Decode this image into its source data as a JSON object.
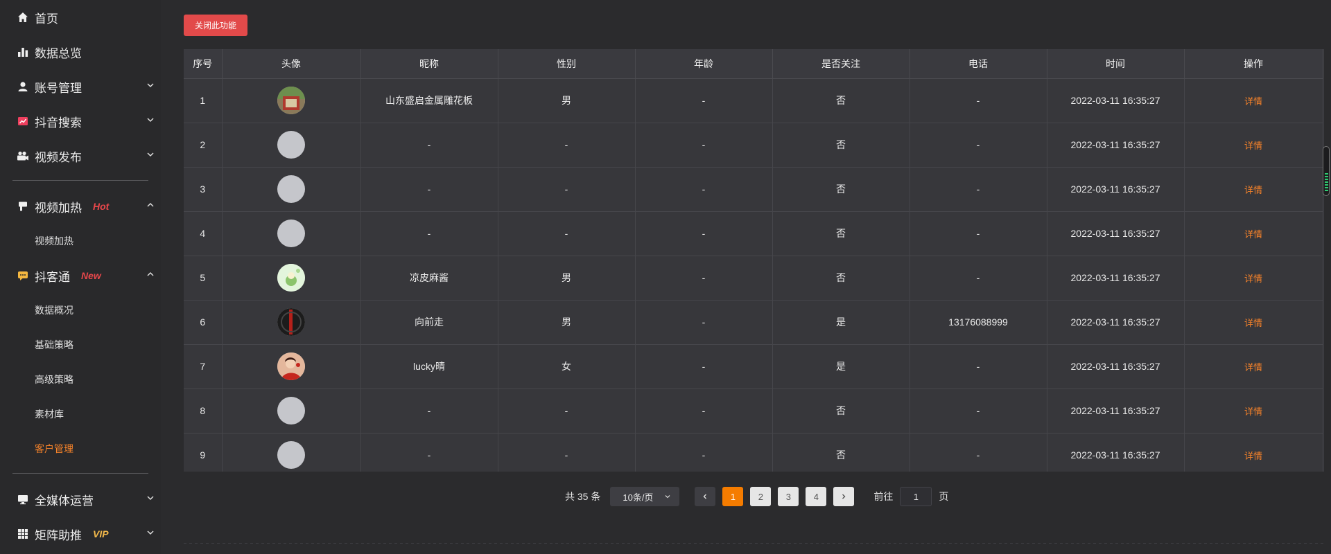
{
  "sidebar": {
    "items": [
      {
        "label": "首页",
        "icon": "home-icon",
        "expand": null
      },
      {
        "label": "数据总览",
        "icon": "bar-chart-icon",
        "expand": null
      },
      {
        "label": "账号管理",
        "icon": "user-icon",
        "expand": "down"
      },
      {
        "label": "抖音搜索",
        "icon": "trend-icon",
        "expand": "down"
      },
      {
        "label": "视频发布",
        "icon": "camera-icon",
        "expand": "down"
      },
      {
        "label": "视频加热",
        "icon": "fire-icon",
        "expand": "up",
        "tag": "Hot",
        "tag_color": "#e8474b"
      },
      {
        "label": "抖客通",
        "icon": "chat-icon",
        "expand": "up",
        "tag": "New",
        "tag_color": "#e8474b"
      },
      {
        "label": "全媒体运营",
        "icon": "monitor-icon",
        "expand": "down"
      },
      {
        "label": "矩阵助推",
        "icon": "grid-icon",
        "expand": "down",
        "tag": "VIP",
        "tag_color": "#f2b84b"
      }
    ],
    "sub_heat": [
      "视频加热"
    ],
    "sub_douke": [
      "数据概况",
      "基础策略",
      "高级策略",
      "素材库",
      "客户管理"
    ],
    "active_sub": "客户管理"
  },
  "toolbar": {
    "close_label": "关闭此功能"
  },
  "table": {
    "headers": [
      "序号",
      "头像",
      "昵称",
      "性别",
      "年龄",
      "是否关注",
      "电话",
      "时间",
      "操作"
    ],
    "rows": [
      {
        "no": "1",
        "avatar": "photo-red-gate",
        "nick": "山东盛启金属雕花板",
        "gender": "男",
        "age": "-",
        "follow": "否",
        "phone": "-",
        "time": "2022-03-11 16:35:27",
        "action": "详情"
      },
      {
        "no": "2",
        "avatar": "default",
        "nick": "-",
        "gender": "-",
        "age": "-",
        "follow": "否",
        "phone": "-",
        "time": "2022-03-11 16:35:27",
        "action": "详情"
      },
      {
        "no": "3",
        "avatar": "default",
        "nick": "-",
        "gender": "-",
        "age": "-",
        "follow": "否",
        "phone": "-",
        "time": "2022-03-11 16:35:27",
        "action": "详情"
      },
      {
        "no": "4",
        "avatar": "default",
        "nick": "-",
        "gender": "-",
        "age": "-",
        "follow": "否",
        "phone": "-",
        "time": "2022-03-11 16:35:27",
        "action": "详情"
      },
      {
        "no": "5",
        "avatar": "cartoon-green",
        "nick": "凉皮麻酱",
        "gender": "男",
        "age": "-",
        "follow": "否",
        "phone": "-",
        "time": "2022-03-11 16:35:27",
        "action": "详情"
      },
      {
        "no": "6",
        "avatar": "dark-red-line",
        "nick": "向前走",
        "gender": "男",
        "age": "-",
        "follow": "是",
        "phone": "13176088999",
        "time": "2022-03-11 16:35:27",
        "action": "详情"
      },
      {
        "no": "7",
        "avatar": "girl-red",
        "nick": "lucky晴",
        "gender": "女",
        "age": "-",
        "follow": "是",
        "phone": "-",
        "time": "2022-03-11 16:35:27",
        "action": "详情"
      },
      {
        "no": "8",
        "avatar": "default",
        "nick": "-",
        "gender": "-",
        "age": "-",
        "follow": "否",
        "phone": "-",
        "time": "2022-03-11 16:35:27",
        "action": "详情"
      },
      {
        "no": "9",
        "avatar": "default",
        "nick": "-",
        "gender": "-",
        "age": "-",
        "follow": "否",
        "phone": "-",
        "time": "2022-03-11 16:35:27",
        "action": "详情"
      }
    ]
  },
  "pagination": {
    "total_text": "共 35 条",
    "page_size": "10条/页",
    "pages": [
      "1",
      "2",
      "3",
      "4"
    ],
    "current": "1",
    "goto_label": "前往",
    "goto_value": "1",
    "page_unit": "页"
  },
  "colors": {
    "accent": "#f57c00",
    "danger": "#e24a4a",
    "link": "#f5822a"
  }
}
